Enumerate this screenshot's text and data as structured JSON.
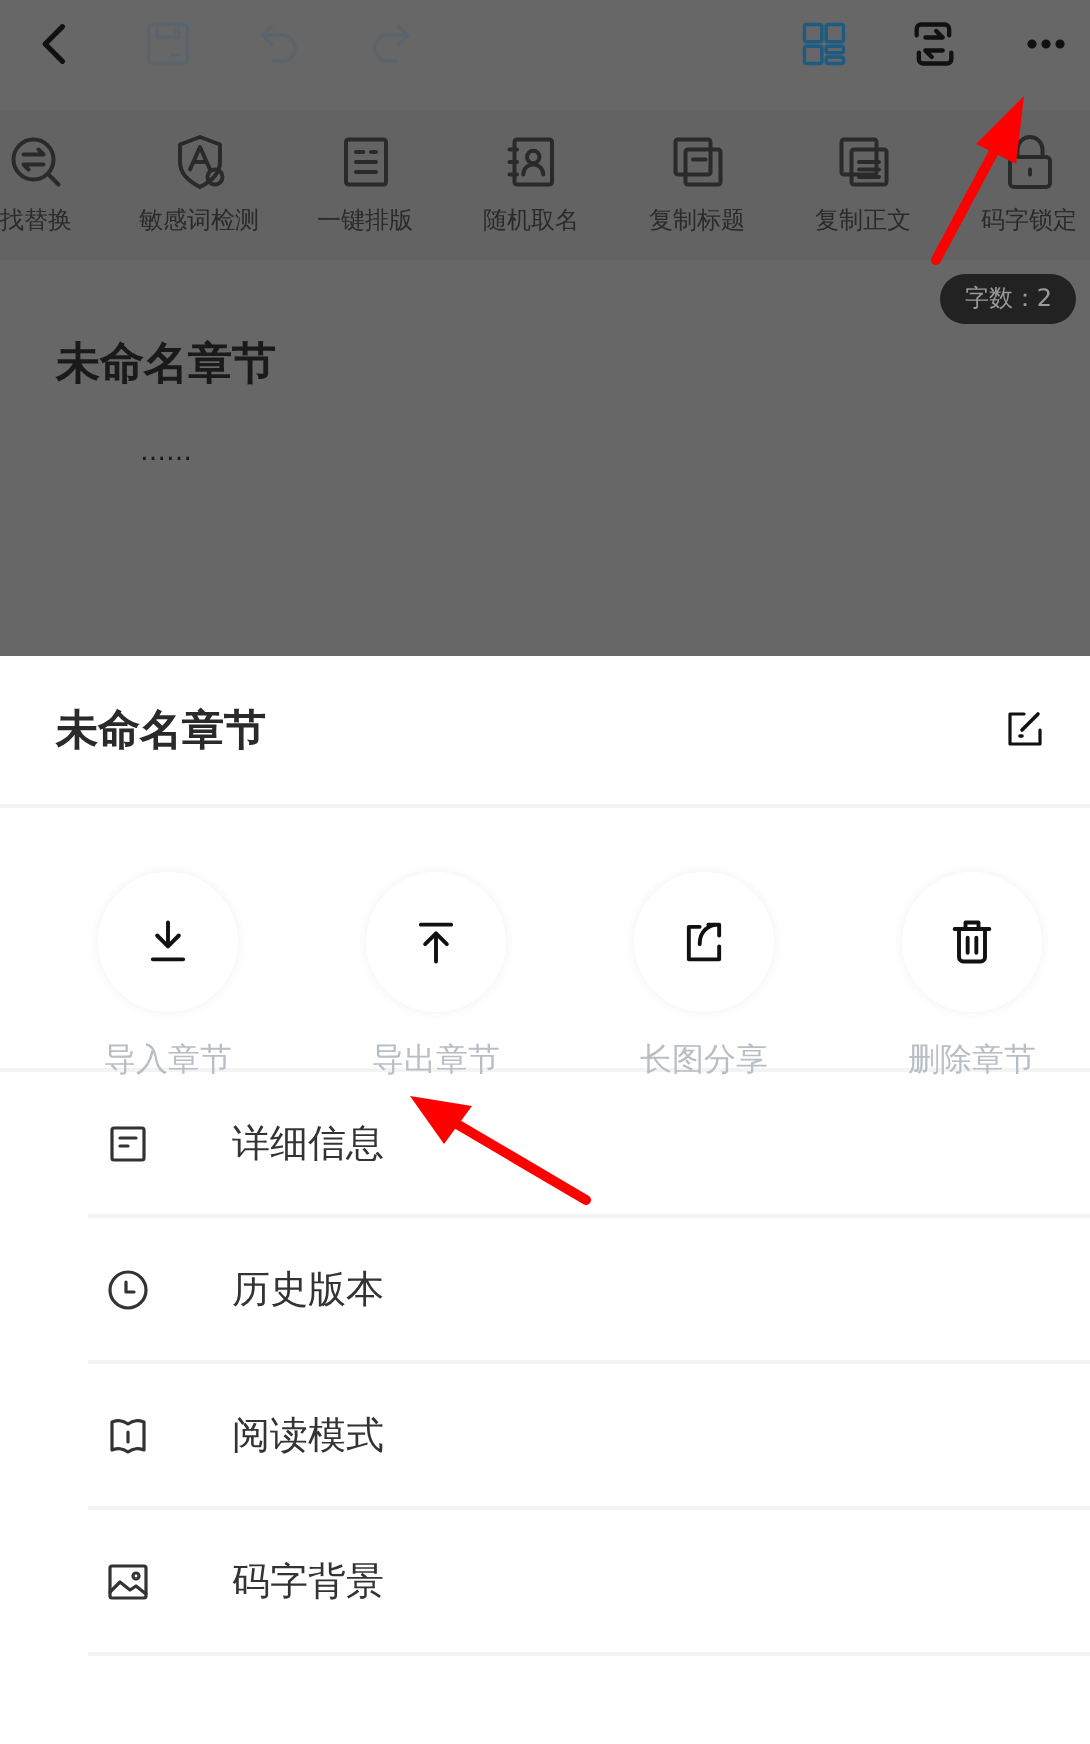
{
  "top_bar": {
    "buttons": [
      {
        "kind": "back",
        "disabled": false
      },
      {
        "kind": "save",
        "disabled": true
      },
      {
        "kind": "undo",
        "disabled": true
      },
      {
        "kind": "redo",
        "disabled": true
      },
      {
        "kind": "grid",
        "disabled": false
      },
      {
        "kind": "switch",
        "disabled": false
      },
      {
        "kind": "more",
        "disabled": false
      }
    ]
  },
  "tools": [
    {
      "kind": "replace",
      "label": "找替换"
    },
    {
      "kind": "sensitive",
      "label": "敏感词检测"
    },
    {
      "kind": "format",
      "label": "一键排版"
    },
    {
      "kind": "name",
      "label": "随机取名"
    },
    {
      "kind": "copy-title",
      "label": "复制标题"
    },
    {
      "kind": "copy-text",
      "label": "复制正文"
    },
    {
      "kind": "lock",
      "label": "码字锁定"
    }
  ],
  "editor": {
    "word_count": "字数：2",
    "title": "未命名章节",
    "body": "……"
  },
  "sheet": {
    "title": "未命名章节",
    "actions": [
      {
        "kind": "import",
        "label": "导入章节"
      },
      {
        "kind": "export",
        "label": "导出章节"
      },
      {
        "kind": "share",
        "label": "长图分享"
      },
      {
        "kind": "delete",
        "label": "删除章节"
      }
    ],
    "menu": [
      {
        "kind": "info",
        "label": "详细信息"
      },
      {
        "kind": "history",
        "label": "历史版本"
      },
      {
        "kind": "read",
        "label": "阅读模式"
      },
      {
        "kind": "background",
        "label": "码字背景"
      }
    ]
  }
}
